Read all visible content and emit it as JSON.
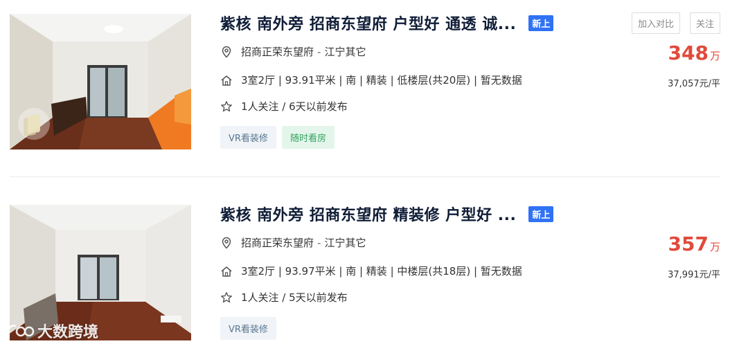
{
  "listings": [
    {
      "title": "紫核 南外旁 招商东望府 户型好 通透 诚...",
      "new_tag": "新上",
      "compare_label": "加入对比",
      "follow_label": "关注",
      "community": "招商正荣东望府",
      "address_sep": "-",
      "district": "江宁其它",
      "house_info": "3室2厅 | 93.91平米 | 南 | 精装 | 低楼层(共20层) | 暂无数据",
      "follow_info": "1人关注 / 6天以前发布",
      "tags": [
        "VR看装修",
        "随时看房"
      ],
      "total_price": "348",
      "price_unit": "万",
      "unit_price": "37,057元/平"
    },
    {
      "title": "紫核 南外旁 招商东望府 精装修 户型好 ...",
      "new_tag": "新上",
      "community": "招商正荣东望府",
      "address_sep": "-",
      "district": "江宁其它",
      "house_info": "3室2厅 | 93.97平米 | 南 | 精装 | 中楼层(共18层) | 暂无数据",
      "follow_info": "1人关注 / 5天以前发布",
      "tags": [
        "VR看装修"
      ],
      "total_price": "357",
      "price_unit": "万",
      "unit_price": "37,991元/平"
    }
  ],
  "watermark": "大数跨境",
  "icons": {
    "location": "location-pin-icon",
    "house": "house-icon",
    "star": "star-icon"
  },
  "colors": {
    "price": "#e04b3b",
    "new_tag_bg": "#3072f6",
    "title": "#101d37"
  }
}
